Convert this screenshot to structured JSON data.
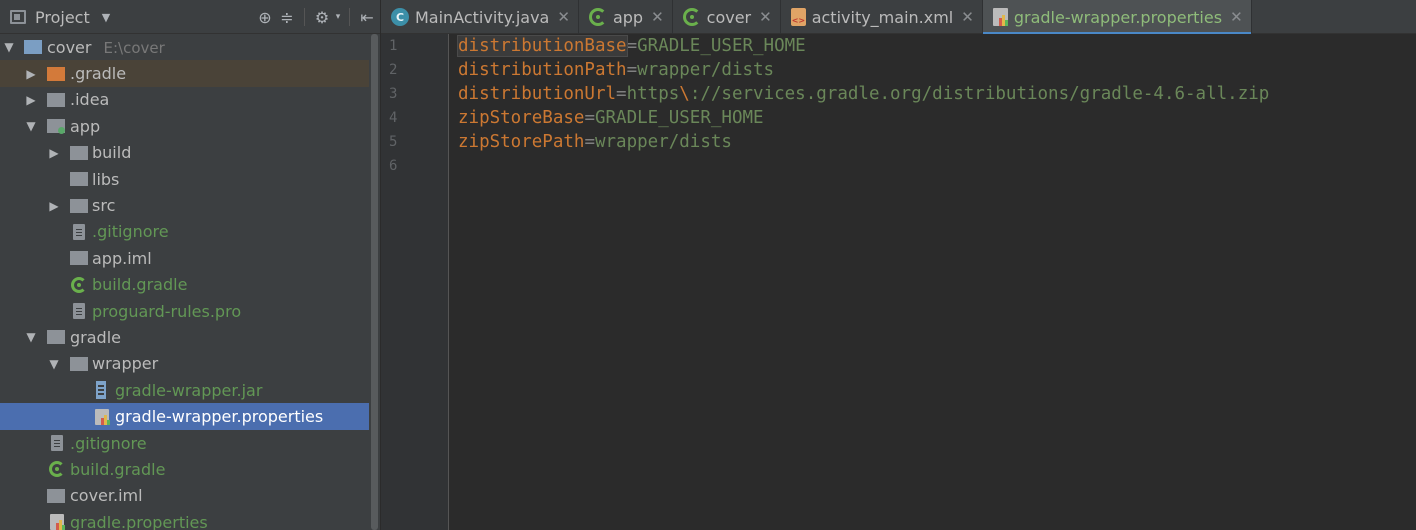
{
  "project_panel": {
    "title": "Project",
    "tree": [
      {
        "label": "cover",
        "note": "E:\\cover"
      },
      {
        "label": ".gradle"
      },
      {
        "label": ".idea"
      },
      {
        "label": "app"
      },
      {
        "label": "build"
      },
      {
        "label": "libs"
      },
      {
        "label": "src"
      },
      {
        "label": ".gitignore"
      },
      {
        "label": "app.iml"
      },
      {
        "label": "build.gradle"
      },
      {
        "label": "proguard-rules.pro"
      },
      {
        "label": "gradle"
      },
      {
        "label": "wrapper"
      },
      {
        "label": "gradle-wrapper.jar"
      },
      {
        "label": "gradle-wrapper.properties"
      },
      {
        "label": ".gitignore"
      },
      {
        "label": "build.gradle"
      },
      {
        "label": "cover.iml"
      },
      {
        "label": "gradle.properties"
      }
    ]
  },
  "tabs": [
    {
      "label": "MainActivity.java",
      "icon": "java-class-icon"
    },
    {
      "label": "app",
      "icon": "gradle-icon"
    },
    {
      "label": "cover",
      "icon": "gradle-icon"
    },
    {
      "label": "activity_main.xml",
      "icon": "xml-file-icon"
    },
    {
      "label": "gradle-wrapper.properties",
      "icon": "properties-file-icon",
      "active": true
    }
  ],
  "editor": {
    "line_numbers": [
      "1",
      "2",
      "3",
      "4",
      "5",
      "6"
    ],
    "lines": [
      {
        "key": "distributionBase",
        "eq": "=",
        "value": "GRADLE_USER_HOME"
      },
      {
        "key": "distributionPath",
        "eq": "=",
        "value": "wrapper/dists"
      },
      {
        "key": "distributionUrl",
        "eq": "=",
        "value_a": "https",
        "escape": "\\",
        "value_b": "://services.gradle.org/distributions/gradle-4.6-all.zip"
      },
      {
        "key": "zipStoreBase",
        "eq": "=",
        "value": "GRADLE_USER_HOME"
      },
      {
        "key": "zipStorePath",
        "eq": "=",
        "value": "wrapper/dists"
      }
    ]
  },
  "colors": {
    "panel_bg": "#3c3f41",
    "editor_bg": "#2b2b2b",
    "selection": "#4b6eaf",
    "key": "#cc7832",
    "value": "#6a8759",
    "active_tab_underline": "#4a88c7"
  }
}
